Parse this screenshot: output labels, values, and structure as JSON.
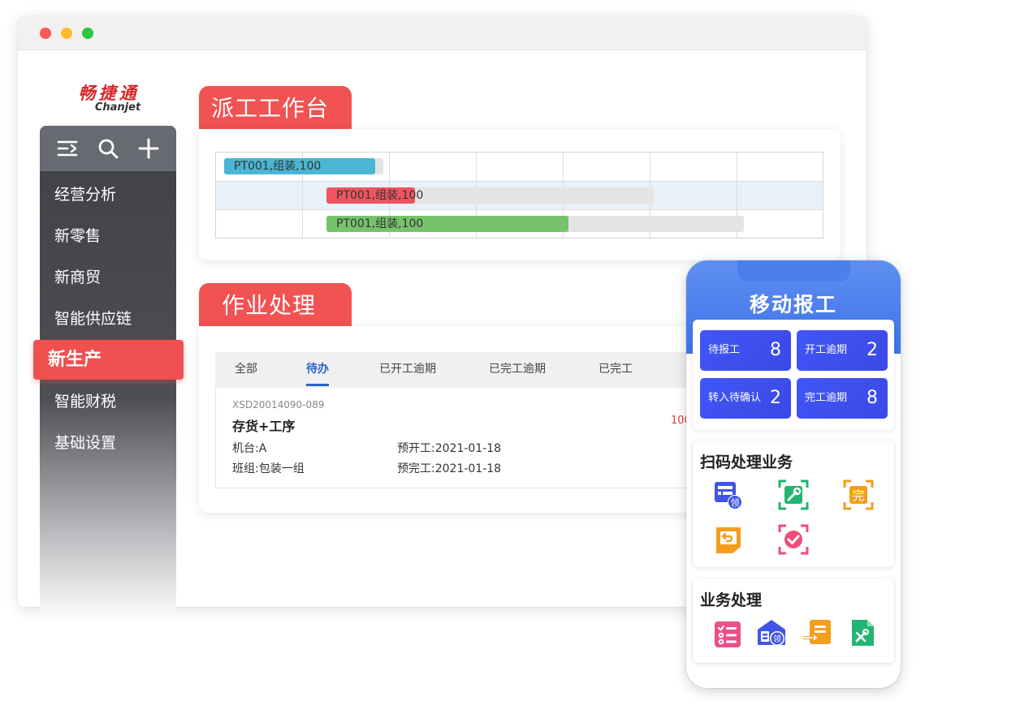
{
  "brand": {
    "name_cn": "畅捷通",
    "name_en": "Chanjet",
    "color": "#d9252a"
  },
  "window": {
    "dots": [
      "#fc5a55",
      "#fdbb2f",
      "#2ac940"
    ]
  },
  "sidebar": {
    "tools": [
      "menu-icon",
      "search-icon",
      "plus-icon"
    ],
    "items": [
      {
        "label": "经营分析"
      },
      {
        "label": "新零售"
      },
      {
        "label": "新商贸"
      },
      {
        "label": "智能供应链"
      },
      {
        "label": "新生产",
        "active": true
      },
      {
        "label": "智能财税"
      },
      {
        "label": "基础设置"
      }
    ]
  },
  "dispatch": {
    "title": "派工工作台",
    "bars": [
      {
        "label": "PT001,组装,100",
        "color": "#4ab6d3",
        "progress": 0.95
      },
      {
        "label": "PT001,组装,100",
        "color": "#ee5560",
        "progress": 0.27
      },
      {
        "label": "PT001,组装,100",
        "color": "#77c36c",
        "progress": 0.58
      }
    ]
  },
  "ops": {
    "title": "作业处理",
    "tabs": [
      "全部",
      "待办",
      "已开工逾期",
      "已完工逾期",
      "已完工"
    ],
    "active_tab": "待办",
    "task": {
      "id": "XSD20014090-089",
      "title": "存货+工序",
      "machine": "机台:A",
      "team": "班组:包装一组",
      "plan_start": "预开工:2021-01-18",
      "plan_finish": "预完工:2021-01-18",
      "right_partial": "100"
    }
  },
  "mobile": {
    "title": "移动报工",
    "stats": [
      {
        "label": "待报工",
        "value": "8"
      },
      {
        "label": "开工逾期",
        "value": "2"
      },
      {
        "label": "转入待确认",
        "value": "2"
      },
      {
        "label": "完工逾期",
        "value": "8"
      }
    ],
    "scan": {
      "title": "扫码处理业务",
      "icons": [
        "scan-receive-icon",
        "scan-repair-icon",
        "scan-complete-icon",
        "scan-return-icon",
        "scan-confirm-icon"
      ],
      "glyph_receive": "领",
      "glyph_complete": "完"
    },
    "business": {
      "title": "业务处理",
      "icons": [
        "checklist-icon",
        "warehouse-receive-icon",
        "transfer-doc-icon",
        "repair-doc-icon"
      ],
      "glyph_receive": "领"
    }
  }
}
